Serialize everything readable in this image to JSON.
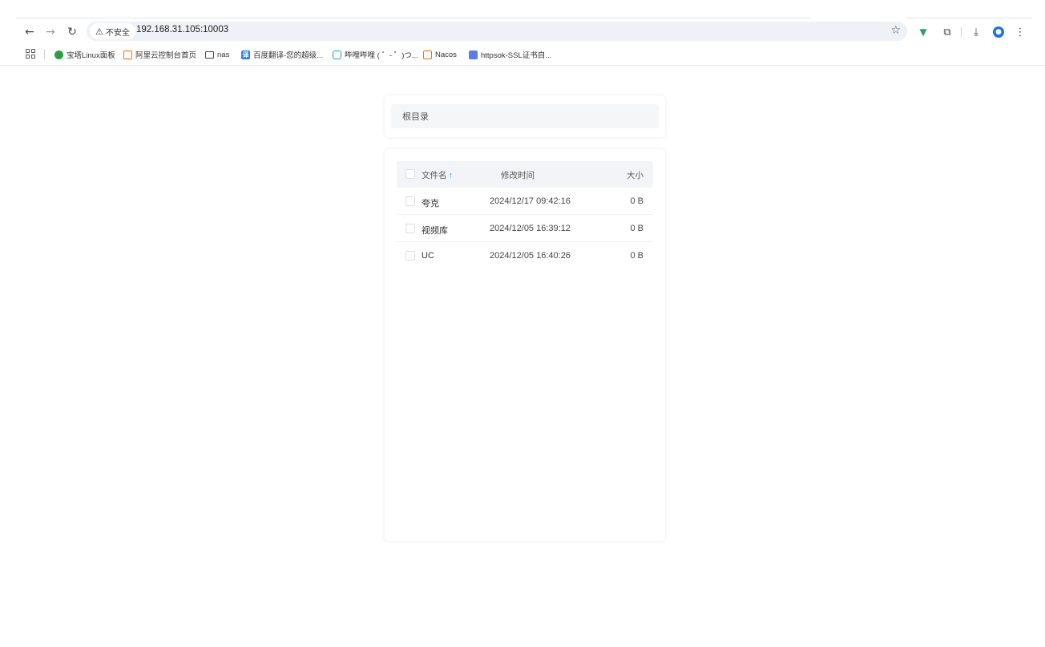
{
  "browser": {
    "security_label": "不安全",
    "url": "192.168.31.105:10003",
    "bookmarks": [
      {
        "label": "宝塔Linux面板",
        "icon": "baota-icon"
      },
      {
        "label": "阿里云控制台首页",
        "icon": "aliyun-icon"
      },
      {
        "label": "nas",
        "icon": "folder-icon"
      },
      {
        "label": "百度翻译-您的超级...",
        "icon": "baidu-translate-icon"
      },
      {
        "label": "哔哩哔哩 ( ゜- ゜)つ...",
        "icon": "bilibili-icon"
      },
      {
        "label": "Nacos",
        "icon": "aliyun-icon"
      },
      {
        "label": "httpsok-SSL证书自...",
        "icon": "ssl-icon"
      }
    ]
  },
  "path": {
    "current": "根目录"
  },
  "table": {
    "headers": {
      "name": "文件名",
      "sort_indicator": "↑",
      "modified": "修改时间",
      "size": "大小"
    },
    "rows": [
      {
        "name": "夸克",
        "modified": "2024/12/17 09:42:16",
        "size": "0 B"
      },
      {
        "name": "视频库",
        "modified": "2024/12/05 16:39:12",
        "size": "0 B"
      },
      {
        "name": "UC",
        "modified": "2024/12/05 16:40:26",
        "size": "0 B"
      }
    ]
  },
  "colors": {
    "accent": "#1a8cff",
    "omnibox_bg": "#eef1f6",
    "header_bg": "#f3f4f7"
  }
}
